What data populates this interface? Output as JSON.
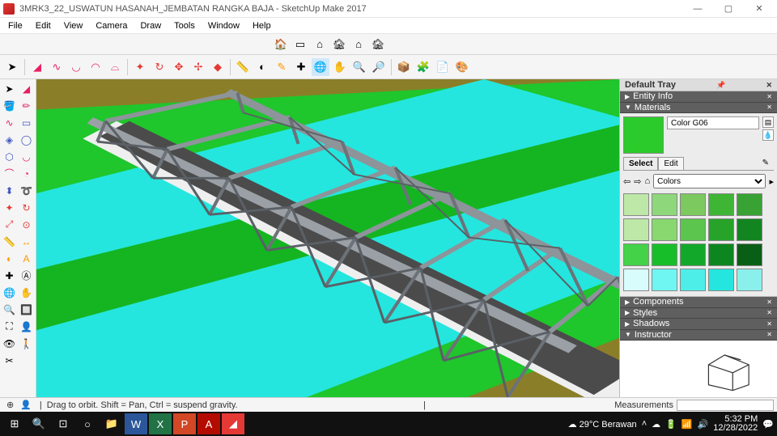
{
  "window": {
    "title": "3MRK3_22_USWATUN HASANAH_JEMBATAN RANGKA BAJA - SketchUp Make 2017"
  },
  "menu": [
    "File",
    "Edit",
    "View",
    "Camera",
    "Draw",
    "Tools",
    "Window",
    "Help"
  ],
  "tray": {
    "title": "Default Tray",
    "entity_info": "Entity Info",
    "materials": {
      "title": "Materials",
      "current_name": "Color G06",
      "tabs": [
        "Select",
        "Edit"
      ],
      "category": "Colors",
      "swatches": [
        "#bee8a7",
        "#8ed77a",
        "#7cc95f",
        "#3fb536",
        "#38a334",
        "#bee8a7",
        "#88d86f",
        "#5bc54e",
        "#26a328",
        "#128521",
        "#43d248",
        "#18be2a",
        "#12a82a",
        "#0e861f",
        "#095f15",
        "#d8fcfc",
        "#6ff5f2",
        "#4eeee8",
        "#24e6df",
        "#8bf0ec"
      ]
    },
    "components": "Components",
    "styles": "Styles",
    "shadows": "Shadows",
    "instructor": "Instructor"
  },
  "status": {
    "hint": "Drag to orbit. Shift = Pan, Ctrl = suspend gravity.",
    "measurements_label": "Measurements"
  },
  "taskbar": {
    "weather": "29°C Berawan",
    "time": "5:32 PM",
    "date": "12/28/2022"
  }
}
